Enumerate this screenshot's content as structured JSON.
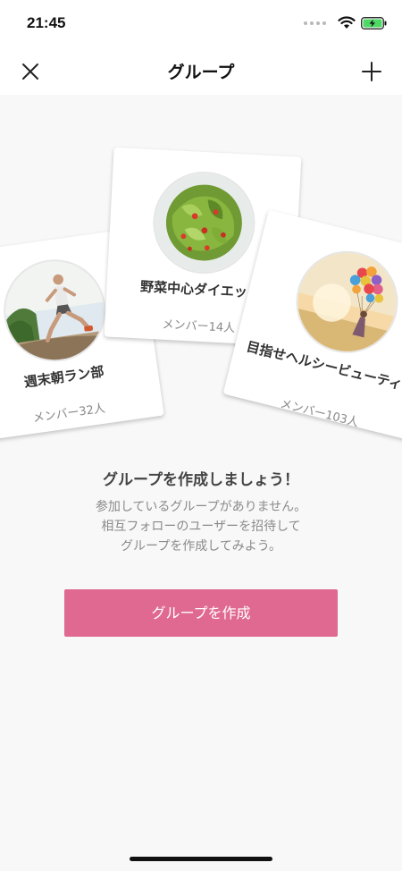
{
  "status": {
    "time": "21:45"
  },
  "nav": {
    "title": "グループ",
    "close_icon": "close-icon",
    "add_icon": "plus-icon"
  },
  "cards": [
    {
      "name": "週末朝ラン部",
      "members": "メンバー32人",
      "image": "runner-photo"
    },
    {
      "name": "野菜中心ダイエット",
      "members": "メンバー14人",
      "image": "salad-photo"
    },
    {
      "name": "目指せヘルシービューティー",
      "members": "メンバー103人",
      "image": "balloons-photo"
    }
  ],
  "empty": {
    "title": "グループを作成しましょう！",
    "lines": [
      "参加しているグループがありません。",
      "相互フォローのユーザーを招待して",
      "グループを作成してみよう。"
    ]
  },
  "button": {
    "label": "グループを作成"
  },
  "colors": {
    "accent": "#e06991",
    "background": "#f8f8f8"
  }
}
